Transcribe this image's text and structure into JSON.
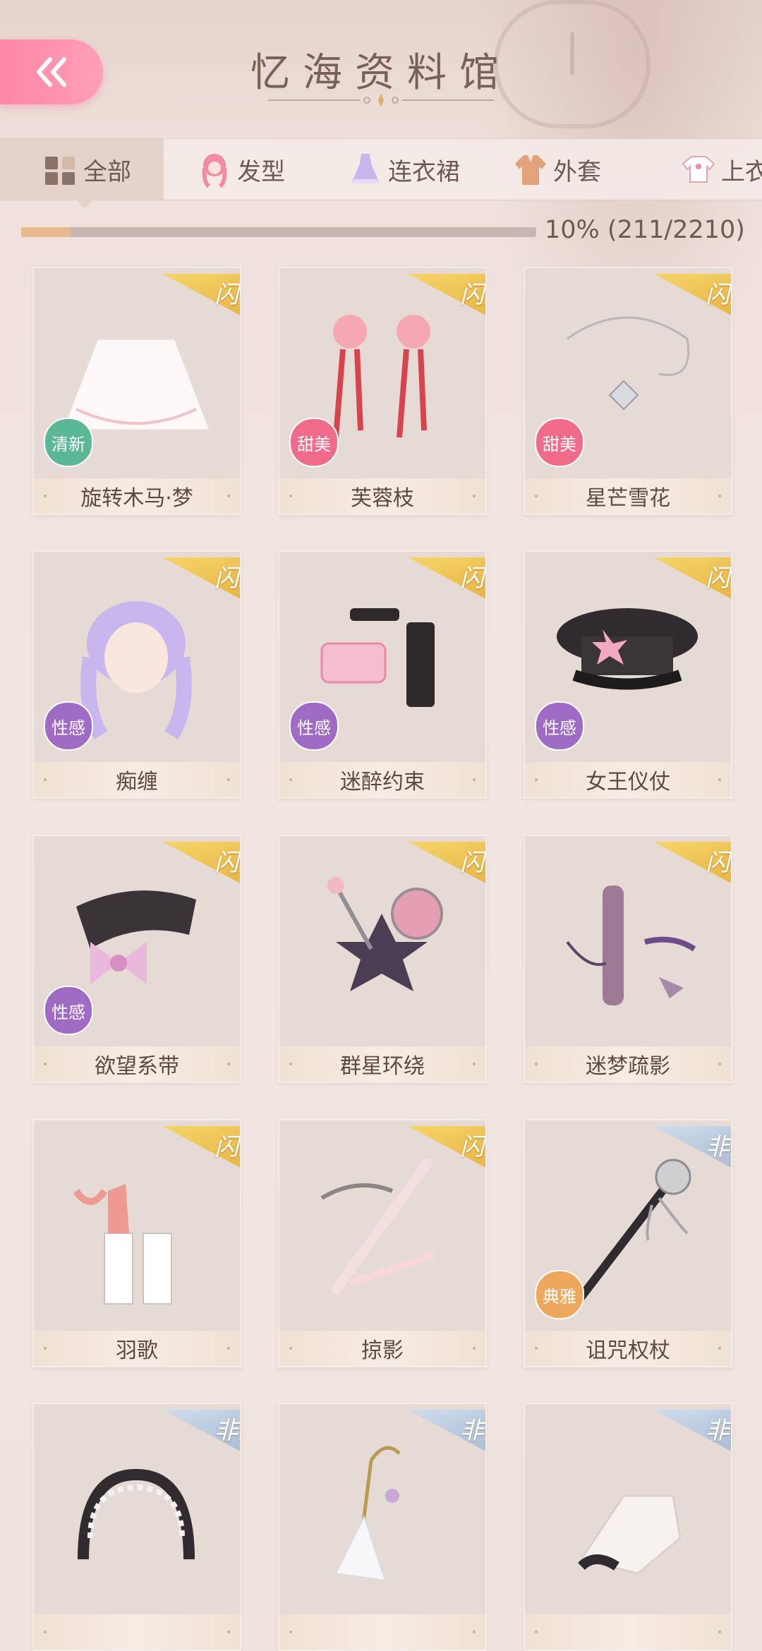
{
  "header": {
    "title": "忆海资料馆"
  },
  "tabs": [
    {
      "label": "全部",
      "icon": "grid-icon",
      "active": true
    },
    {
      "label": "发型",
      "icon": "hair-icon",
      "active": false
    },
    {
      "label": "连衣裙",
      "icon": "dress-icon",
      "active": false
    },
    {
      "label": "外套",
      "icon": "coat-icon",
      "active": false
    },
    {
      "label": "上衣",
      "icon": "top-icon",
      "active": false
    }
  ],
  "progress": {
    "text": "10% (211/2210)",
    "fraction": 0.0955
  },
  "colors": {
    "accent": "#ff8fab",
    "gold_ribbon": "#f0c24a",
    "silver_ribbon": "#a9bcd6",
    "badge_fresh": "#5ab897",
    "badge_sweet": "#f06b8a",
    "badge_sexy": "#a06bc4",
    "badge_elegant": "#eea85e"
  },
  "items": [
    {
      "name": "旋转木马·梦",
      "ribbon": "闪耀",
      "ribbon_type": "gold",
      "badge": "清新",
      "badge_color": "#5ab897",
      "art": "skirt-icon"
    },
    {
      "name": "芙蓉枝",
      "ribbon": "闪耀",
      "ribbon_type": "gold",
      "badge": "甜美",
      "badge_color": "#f06b8a",
      "art": "earring-icon"
    },
    {
      "name": "星芒雪花",
      "ribbon": "闪耀",
      "ribbon_type": "gold",
      "badge": "甜美",
      "badge_color": "#f06b8a",
      "art": "necklace-icon"
    },
    {
      "name": "痴缠",
      "ribbon": "闪耀",
      "ribbon_type": "gold",
      "badge": "性感",
      "badge_color": "#a06bc4",
      "art": "hairstyle-icon"
    },
    {
      "name": "迷醉约束",
      "ribbon": "闪耀",
      "ribbon_type": "gold",
      "badge": "性感",
      "badge_color": "#a06bc4",
      "art": "bracelet-icon"
    },
    {
      "name": "女王仪仗",
      "ribbon": "闪耀",
      "ribbon_type": "gold",
      "badge": "性感",
      "badge_color": "#a06bc4",
      "art": "cap-icon"
    },
    {
      "name": "欲望系带",
      "ribbon": "闪耀",
      "ribbon_type": "gold",
      "badge": "性感",
      "badge_color": "#a06bc4",
      "art": "collar-icon"
    },
    {
      "name": "群星环绕",
      "ribbon": "闪耀",
      "ribbon_type": "gold",
      "badge": "",
      "badge_color": "",
      "art": "makeup-icon"
    },
    {
      "name": "迷梦疏影",
      "ribbon": "闪耀",
      "ribbon_type": "gold",
      "badge": "",
      "badge_color": "",
      "art": "mascara-icon"
    },
    {
      "name": "羽歌",
      "ribbon": "闪耀",
      "ribbon_type": "gold",
      "badge": "",
      "badge_color": "",
      "art": "lipstick-icon"
    },
    {
      "name": "掠影",
      "ribbon": "闪耀",
      "ribbon_type": "gold",
      "badge": "",
      "badge_color": "",
      "art": "brow-pencil-icon"
    },
    {
      "name": "诅咒权杖",
      "ribbon": "非凡",
      "ribbon_type": "silver",
      "badge": "典雅",
      "badge_color": "#eea85e",
      "art": "scepter-icon"
    },
    {
      "name": "",
      "ribbon": "非凡",
      "ribbon_type": "silver",
      "badge": "",
      "badge_color": "",
      "art": "headband-icon"
    },
    {
      "name": "",
      "ribbon": "非凡",
      "ribbon_type": "silver",
      "badge": "",
      "badge_color": "",
      "art": "umbrella-icon"
    },
    {
      "name": "",
      "ribbon": "非凡",
      "ribbon_type": "silver",
      "badge": "",
      "badge_color": "",
      "art": "glove-icon"
    }
  ]
}
